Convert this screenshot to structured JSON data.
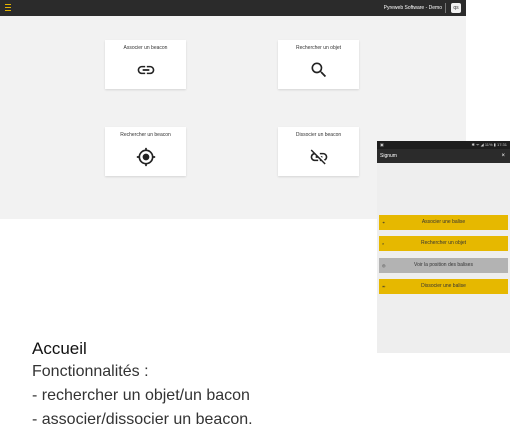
{
  "topbar": {
    "menu_icon": "hamburger-menu-icon",
    "brand": "Pyreweb Software - Demo",
    "avatar": "qs"
  },
  "cards": [
    {
      "label": "Associer un beacon",
      "icon": "link-icon"
    },
    {
      "label": "Rechercher un objet",
      "icon": "search-icon"
    },
    {
      "label": "Rechercher un beacon",
      "icon": "gps-target-icon"
    },
    {
      "label": "Dissocier un beacon",
      "icon": "unlink-icon"
    }
  ],
  "phone": {
    "status_left": "▣",
    "status_right": "✱ ᯤ ◢ 11% ▮ 17:31",
    "title": "Signum",
    "close": "×",
    "buttons": [
      {
        "icon": "link-icon",
        "label": "Associer une balise",
        "color": "#e6b800"
      },
      {
        "icon": "search-icon",
        "label": "Rechercher un objet",
        "color": "#e6b800"
      },
      {
        "icon": "location-icon",
        "label": "Voir la position des balises",
        "color": "#b3b3b3"
      },
      {
        "icon": "unlink-icon",
        "label": "Dissocier une balise",
        "color": "#e6b800"
      }
    ]
  },
  "description": {
    "title": "Accueil",
    "lines": [
      "Fonctionnalités :",
      "- rechercher un objet/un bacon",
      "- associer/dissocier un beacon."
    ]
  },
  "colors": {
    "accent": "#e6b800",
    "appbar": "#2b2b2b",
    "panel": "#f2f2f2"
  }
}
